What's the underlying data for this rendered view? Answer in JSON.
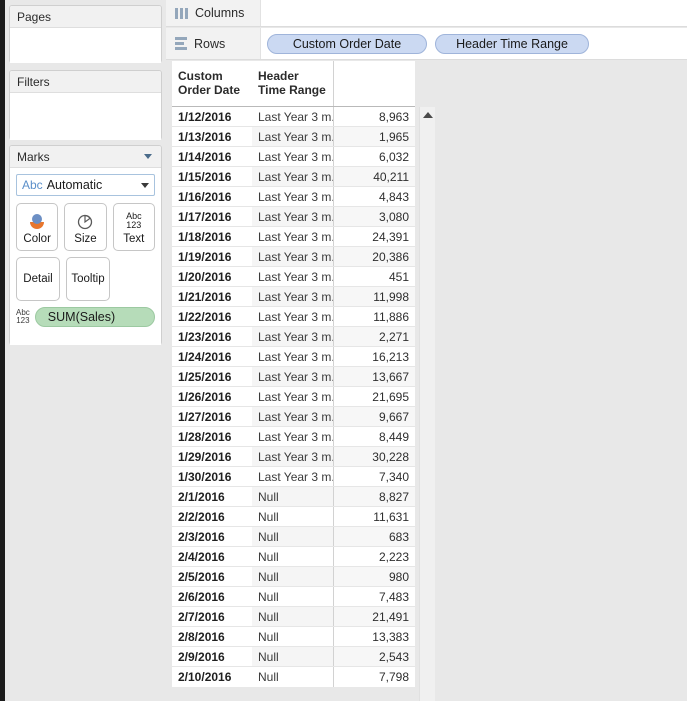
{
  "cards": {
    "pages": {
      "title": "Pages"
    },
    "filters": {
      "title": "Filters"
    },
    "marks": {
      "title": "Marks",
      "mark_type": {
        "prefix": "Abc",
        "value": "Automatic"
      },
      "buttons": [
        {
          "id": "color",
          "label": "Color",
          "icon": "color-circles-icon"
        },
        {
          "id": "size",
          "label": "Size",
          "icon": "size-pie-icon"
        },
        {
          "id": "text",
          "label": "Text",
          "icon": "abc123-icon",
          "glyph_top": "Abc",
          "glyph_bottom": "123"
        },
        {
          "id": "detail",
          "label": "Detail",
          "icon": "detail-icon"
        },
        {
          "id": "tooltip",
          "label": "Tooltip",
          "icon": "tooltip-icon"
        }
      ],
      "field_pill": {
        "icon_top": "Abc",
        "icon_bottom": "123",
        "label": "SUM(Sales)",
        "color": "#b6dcb9"
      }
    }
  },
  "shelves": {
    "columns": {
      "label": "Columns",
      "icon": "columns-bars-icon",
      "pills": []
    },
    "rows": {
      "label": "Rows",
      "icon": "rows-lines-icon",
      "pills": [
        {
          "label": "Custom Order Date",
          "color": "#cbd9f2"
        },
        {
          "label": "Header Time Range",
          "color": "#cbd9f2"
        }
      ]
    }
  },
  "table": {
    "headers": [
      "Custom Order Date",
      "Header Time Range",
      ""
    ],
    "rows": [
      {
        "date": "1/12/2016",
        "range": "Last Year 3 m..",
        "value": "8,963"
      },
      {
        "date": "1/13/2016",
        "range": "Last Year 3 m..",
        "value": "1,965"
      },
      {
        "date": "1/14/2016",
        "range": "Last Year 3 m..",
        "value": "6,032"
      },
      {
        "date": "1/15/2016",
        "range": "Last Year 3 m..",
        "value": "40,211"
      },
      {
        "date": "1/16/2016",
        "range": "Last Year 3 m..",
        "value": "4,843"
      },
      {
        "date": "1/17/2016",
        "range": "Last Year 3 m..",
        "value": "3,080"
      },
      {
        "date": "1/18/2016",
        "range": "Last Year 3 m..",
        "value": "24,391"
      },
      {
        "date": "1/19/2016",
        "range": "Last Year 3 m..",
        "value": "20,386"
      },
      {
        "date": "1/20/2016",
        "range": "Last Year 3 m..",
        "value": "451"
      },
      {
        "date": "1/21/2016",
        "range": "Last Year 3 m..",
        "value": "11,998"
      },
      {
        "date": "1/22/2016",
        "range": "Last Year 3 m..",
        "value": "11,886"
      },
      {
        "date": "1/23/2016",
        "range": "Last Year 3 m..",
        "value": "2,271"
      },
      {
        "date": "1/24/2016",
        "range": "Last Year 3 m..",
        "value": "16,213"
      },
      {
        "date": "1/25/2016",
        "range": "Last Year 3 m..",
        "value": "13,667"
      },
      {
        "date": "1/26/2016",
        "range": "Last Year 3 m..",
        "value": "21,695"
      },
      {
        "date": "1/27/2016",
        "range": "Last Year 3 m..",
        "value": "9,667"
      },
      {
        "date": "1/28/2016",
        "range": "Last Year 3 m..",
        "value": "8,449"
      },
      {
        "date": "1/29/2016",
        "range": "Last Year 3 m..",
        "value": "30,228"
      },
      {
        "date": "1/30/2016",
        "range": "Last Year 3 m..",
        "value": "7,340"
      },
      {
        "date": "2/1/2016",
        "range": "Null",
        "value": "8,827"
      },
      {
        "date": "2/2/2016",
        "range": "Null",
        "value": "11,631"
      },
      {
        "date": "2/3/2016",
        "range": "Null",
        "value": "683"
      },
      {
        "date": "2/4/2016",
        "range": "Null",
        "value": "2,223"
      },
      {
        "date": "2/5/2016",
        "range": "Null",
        "value": "980"
      },
      {
        "date": "2/6/2016",
        "range": "Null",
        "value": "7,483"
      },
      {
        "date": "2/7/2016",
        "range": "Null",
        "value": "21,491"
      },
      {
        "date": "2/8/2016",
        "range": "Null",
        "value": "13,383"
      },
      {
        "date": "2/9/2016",
        "range": "Null",
        "value": "2,543"
      },
      {
        "date": "2/10/2016",
        "range": "Null",
        "value": "7,798"
      }
    ]
  },
  "scrollbar": {
    "up_arrow_icon": "scroll-up-arrow-icon"
  }
}
